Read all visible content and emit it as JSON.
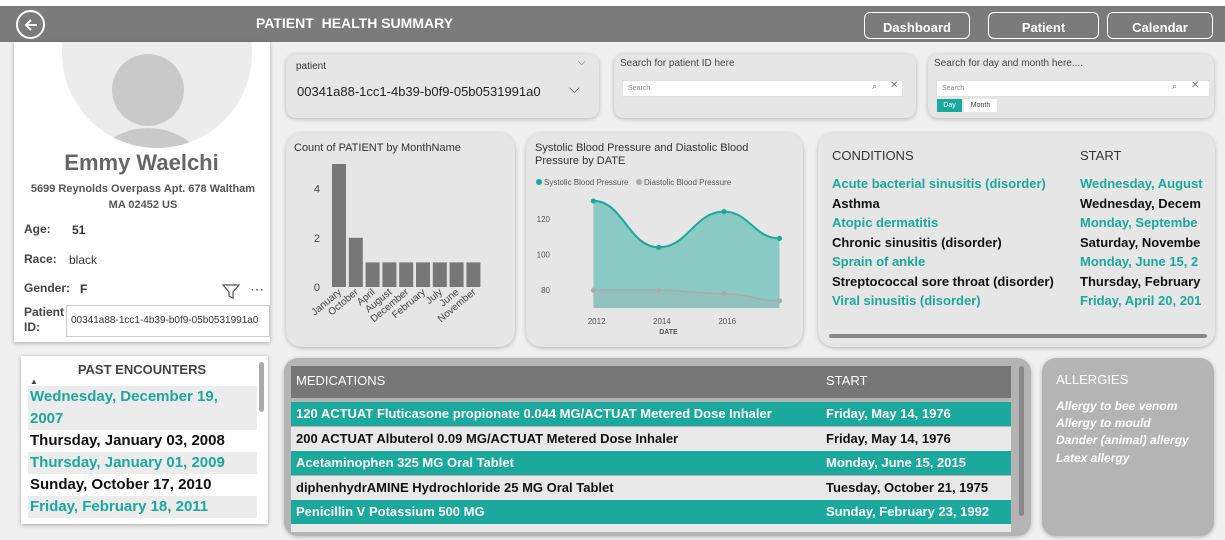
{
  "header": {
    "title": "PATIENT  HEALTH SUMMARY",
    "nav": [
      "Dashboard",
      "Patient",
      "Calendar"
    ]
  },
  "patient": {
    "name": "Emmy Waelchi",
    "address_line1": "5699 Reynolds Overpass Apt. 678 Waltham",
    "address_line2": "MA 02452 US",
    "age_label": "Age:",
    "age": "51",
    "race_label": "Race:",
    "race": "black",
    "gender_label": "Gender:",
    "gender": "F",
    "id_label_1": "Patient",
    "id_label_2": "ID:",
    "id": "00341a88-1cc1-4b39-b0f9-05b0531991a0"
  },
  "encounters": {
    "title": "PAST ENCOUNTERS",
    "items": [
      {
        "line1": "Wednesday, December 19,",
        "line2": "2007",
        "style": "teal"
      },
      {
        "line1": "Thursday, January 03, 2008",
        "style": "dark"
      },
      {
        "line1": "Thursday, January 01, 2009",
        "style": "teal"
      },
      {
        "line1": "Sunday, October 17, 2010",
        "style": "dark"
      },
      {
        "line1": "Friday, February 18, 2011",
        "style": "teal"
      }
    ]
  },
  "slicers": {
    "patient_label": "patient",
    "patient_value": "00341a88-1cc1-4b39-b0f9-05b0531991a0",
    "id_search_label": "Search for patient ID here",
    "day_search_label": "Search for day and month here....",
    "search_placeholder": "Search",
    "day_btn": "Day",
    "month_btn": "Month"
  },
  "bar_chart": {
    "chart_data": {
      "type": "bar",
      "title": "Count of PATIENT by MonthName",
      "categories": [
        "January",
        "October",
        "April",
        "August",
        "December",
        "February",
        "July",
        "June",
        "November"
      ],
      "values": [
        5,
        2,
        1,
        1,
        1,
        1,
        1,
        1,
        1
      ],
      "ylim": [
        0,
        5
      ],
      "yticks": [
        "0",
        "2",
        "4"
      ],
      "color": "#777777"
    }
  },
  "line_chart": {
    "chart_data": {
      "type": "area",
      "title_line1": "Systolic Blood Pressure and Diastolic Blood",
      "title_line2": "Pressure by DATE",
      "xlabel": "DATE",
      "xticks": [
        "2012",
        "2014",
        "2016"
      ],
      "yticks": [
        "80",
        "100",
        "120"
      ],
      "ylim": [
        70,
        135
      ],
      "x": [
        2011.9,
        2013.9,
        2015.9,
        2017.6
      ],
      "series": [
        {
          "name": "Systolic Blood Pressure",
          "color": "#1ba89d",
          "values": [
            130,
            104,
            124,
            109
          ]
        },
        {
          "name": "Diastolic Blood Pressure",
          "color": "#aaaaaa",
          "values": [
            80,
            80,
            78,
            74
          ]
        }
      ]
    }
  },
  "conditions": {
    "col1": "CONDITIONS",
    "col2": "START",
    "rows": [
      {
        "name": "Acute bacterial sinusitis (disorder)",
        "start": "Wednesday, August",
        "style": "teal"
      },
      {
        "name": "Asthma",
        "start": "Wednesday, Decem",
        "style": "dark"
      },
      {
        "name": "Atopic dermatitis",
        "start": "Monday, Septembe",
        "style": "teal"
      },
      {
        "name": "Chronic sinusitis (disorder)",
        "start": "Saturday, Novembe",
        "style": "dark"
      },
      {
        "name": "Sprain of ankle",
        "start": "Monday, June 15, 2",
        "style": "teal"
      },
      {
        "name": "Streptococcal sore throat (disorder)",
        "start": "Thursday, February",
        "style": "dark"
      },
      {
        "name": "Viral sinusitis (disorder)",
        "start": "Friday, April 20, 201",
        "style": "teal"
      }
    ]
  },
  "medications": {
    "col1": "MEDICATIONS",
    "col2": "START",
    "rows": [
      {
        "name": "120 ACTUAT Fluticasone propionate 0.044 MG/ACTUAT Metered Dose Inhaler",
        "start": "Friday, May 14, 1976",
        "style": "t"
      },
      {
        "name": "200 ACTUAT Albuterol 0.09 MG/ACTUAT Metered Dose Inhaler",
        "start": "Friday, May 14, 1976",
        "style": "w"
      },
      {
        "name": "Acetaminophen 325 MG Oral Tablet",
        "start": "Monday, June 15, 2015",
        "style": "t"
      },
      {
        "name": "diphenhydrAMINE Hydrochloride 25 MG Oral Tablet",
        "start": "Tuesday, October 21, 1975",
        "style": "w"
      },
      {
        "name": "Penicillin V Potassium 500 MG",
        "start": "Sunday, February 23, 1992",
        "style": "t"
      }
    ]
  },
  "allergies": {
    "title": "ALLERGIES",
    "items": [
      "Allergy to bee venom",
      "Allergy to mould",
      "Dander (animal) allergy",
      "Latex allergy"
    ]
  }
}
